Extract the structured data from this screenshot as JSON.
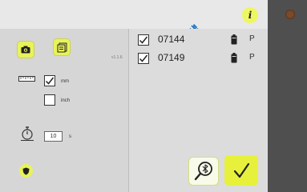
{
  "header": {
    "info_label": "i"
  },
  "settings": {
    "version": "v1.1.6",
    "units": {
      "mm_label": "mm",
      "mm_checked": true,
      "inch_label": "inch",
      "inch_checked": false
    },
    "timeout": {
      "value": "10",
      "unit": "s"
    }
  },
  "devices": [
    {
      "id": "07144",
      "checked": true,
      "status": "P"
    },
    {
      "id": "07149",
      "checked": true,
      "status": "P"
    }
  ],
  "colors": {
    "accent": "#e7f13c",
    "left_panel": "#d6d6d6",
    "right_panel": "#dcdcdc",
    "bezel": "#4f4f4f"
  },
  "icons": {
    "camera": "camera-icon",
    "document": "document-icon",
    "info": "info-icon",
    "bluetooth": "bluetooth-icon",
    "ruler": "ruler-icon",
    "stopwatch": "stopwatch-icon",
    "shield": "shield-icon",
    "battery": "battery-icon",
    "scan": "bluetooth-search-icon",
    "confirm": "checkmark-icon"
  }
}
